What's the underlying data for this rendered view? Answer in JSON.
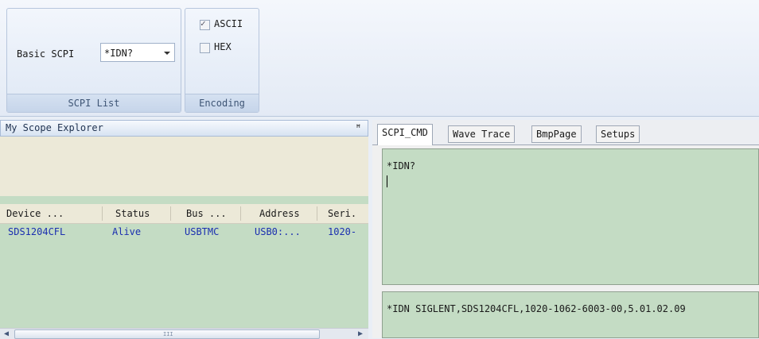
{
  "ribbon": {
    "scpi_group": {
      "label": "Basic SCPI",
      "combo_value": "*IDN?",
      "caption": "SCPI List"
    },
    "encoding_group": {
      "ascii_label": "ASCII",
      "ascii_checked": true,
      "hex_label": "HEX",
      "hex_checked": false,
      "caption": "Encoding"
    }
  },
  "explorer": {
    "title": "My Scope Explorer",
    "pin_icon": "pin-icon",
    "columns": [
      "Device ...",
      "Status",
      "Bus ...",
      "Address",
      "Seri."
    ],
    "rows": [
      [
        "SDS1204CFL",
        "Alive",
        "USBTMC",
        "USB0:...",
        "1020-"
      ]
    ],
    "scroll_grip": "III"
  },
  "tabs": [
    "SCPI_CMD",
    "Wave Trace",
    "BmpPage",
    "Setups"
  ],
  "command_text": "*IDN?",
  "response_text": "*IDN SIGLENT,SDS1204CFL,1020-1062-6003-00,5.01.02.09",
  "colors": {
    "panel_green": "#c4dcc4",
    "row_text": "#1b2fb0",
    "ribbon_bg": "#e3eaf5"
  }
}
